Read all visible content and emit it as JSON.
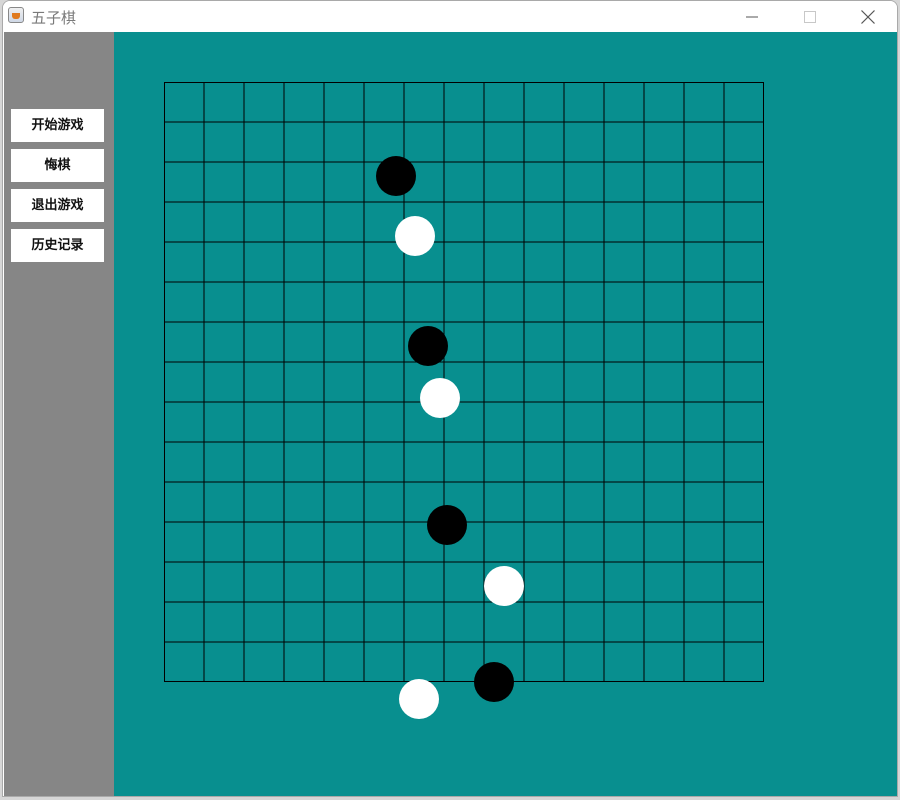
{
  "window": {
    "title": "五子棋",
    "icon": "java-cup-icon",
    "controls": [
      "minimize-icon",
      "maximize-icon",
      "close-icon"
    ]
  },
  "menu": {
    "buttons": [
      {
        "label": "开始游戏"
      },
      {
        "label": "悔棋"
      },
      {
        "label": "退出游戏"
      },
      {
        "label": "历史记录"
      }
    ]
  },
  "board": {
    "grid_cells": 15,
    "colors": {
      "background": "#088f8f",
      "line": "#000000",
      "panel": "#868686"
    },
    "stones": [
      {
        "color": "black",
        "col": 5.8,
        "row": 2.35
      },
      {
        "color": "white",
        "col": 6.28,
        "row": 3.85
      },
      {
        "color": "black",
        "col": 6.6,
        "row": 6.6
      },
      {
        "color": "white",
        "col": 6.9,
        "row": 7.9
      },
      {
        "color": "black",
        "col": 7.07,
        "row": 11.07
      },
      {
        "color": "white",
        "col": 8.5,
        "row": 12.6
      },
      {
        "color": "black",
        "col": 8.25,
        "row": 15.0
      },
      {
        "color": "white",
        "col": 6.38,
        "row": 15.42
      }
    ]
  }
}
